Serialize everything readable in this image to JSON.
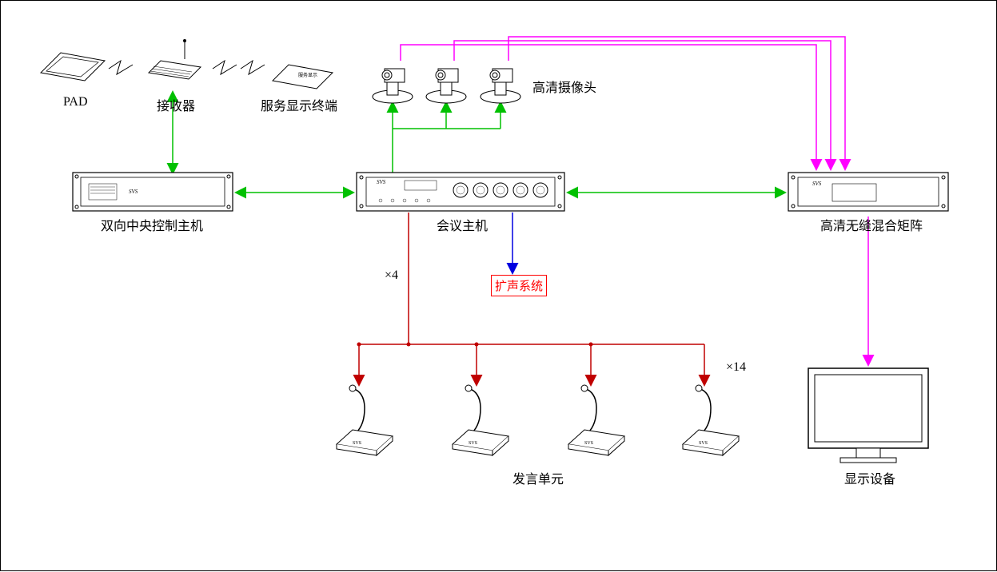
{
  "labels": {
    "pad": "PAD",
    "receiver": "接收器",
    "service_terminal": "服务显示终端",
    "camera": "高清摄像头",
    "center_host": "双向中央控制主机",
    "conf_host": "会议主机",
    "matrix": "高清无缝混合矩阵",
    "amp_system": "扩声系统",
    "speech_unit": "发言单元",
    "display": "显示设备",
    "mult4": "×4",
    "mult14": "×14",
    "brand": "SVS"
  }
}
